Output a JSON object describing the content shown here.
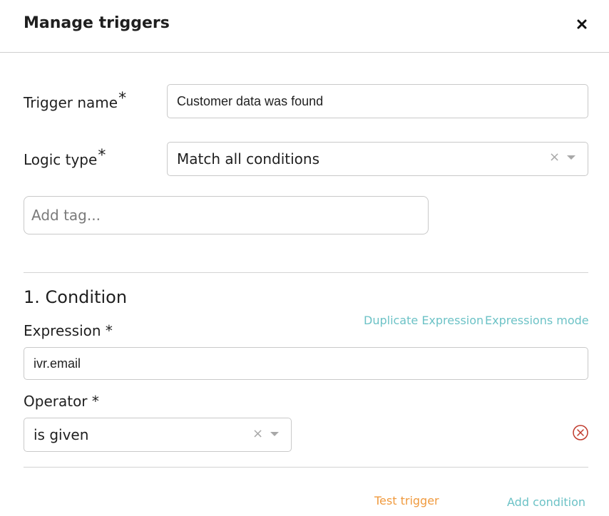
{
  "dialog": {
    "title": "Manage triggers",
    "close_icon": "close-icon"
  },
  "form": {
    "trigger_name": {
      "label": "Trigger name",
      "required_mark": "*",
      "value": "Customer data was found"
    },
    "logic_type": {
      "label": "Logic type",
      "required_mark": "*",
      "value": "Match all conditions",
      "clear_glyph": "×"
    },
    "tags": {
      "placeholder": "Add tag..."
    }
  },
  "condition": {
    "heading": "1. Condition",
    "duplicate_label": "Duplicate Expression",
    "expressions_mode_label": "Expressions mode",
    "expression": {
      "label": "Expression *",
      "value": "ivr.email"
    },
    "operator": {
      "label": "Operator *",
      "value": "is given",
      "clear_glyph": "×"
    },
    "remove_icon": "circle-x-icon"
  },
  "footer": {
    "test_trigger_label": "Test trigger",
    "add_condition_label": "Add condition"
  },
  "colors": {
    "link": "#6cc2c6",
    "test_link": "#f09a3e",
    "remove": "#c0392b"
  }
}
